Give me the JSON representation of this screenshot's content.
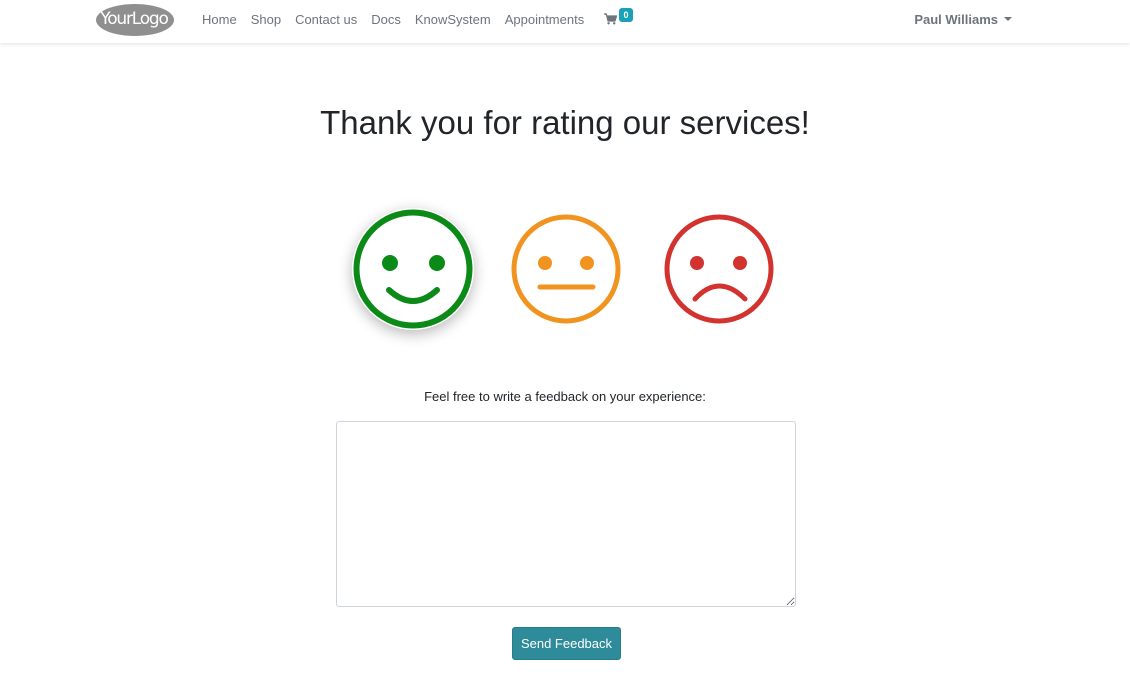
{
  "navbar": {
    "logo_text": "YourLogo",
    "links": [
      "Home",
      "Shop",
      "Contact us",
      "Docs",
      "KnowSystem",
      "Appointments"
    ],
    "cart_icon": "shopping-cart-icon",
    "cart_count": "0",
    "user_name": "Paul Williams"
  },
  "page": {
    "title": "Thank you for rating our services!"
  },
  "ratings": [
    {
      "name": "satisfied",
      "icon": "smiley-happy-icon",
      "color": "#0b8a18",
      "selected": true
    },
    {
      "name": "neutral",
      "icon": "smiley-neutral-icon",
      "color": "#f0931f",
      "selected": false
    },
    {
      "name": "dissatisfied",
      "icon": "smiley-sad-icon",
      "color": "#d2332f",
      "selected": false
    }
  ],
  "feedback": {
    "label": "Feel free to write a feedback on your experience:",
    "value": "",
    "button_label": "Send Feedback"
  },
  "colors": {
    "primary": "#2e8b9a",
    "badge": "#17a2b8"
  }
}
